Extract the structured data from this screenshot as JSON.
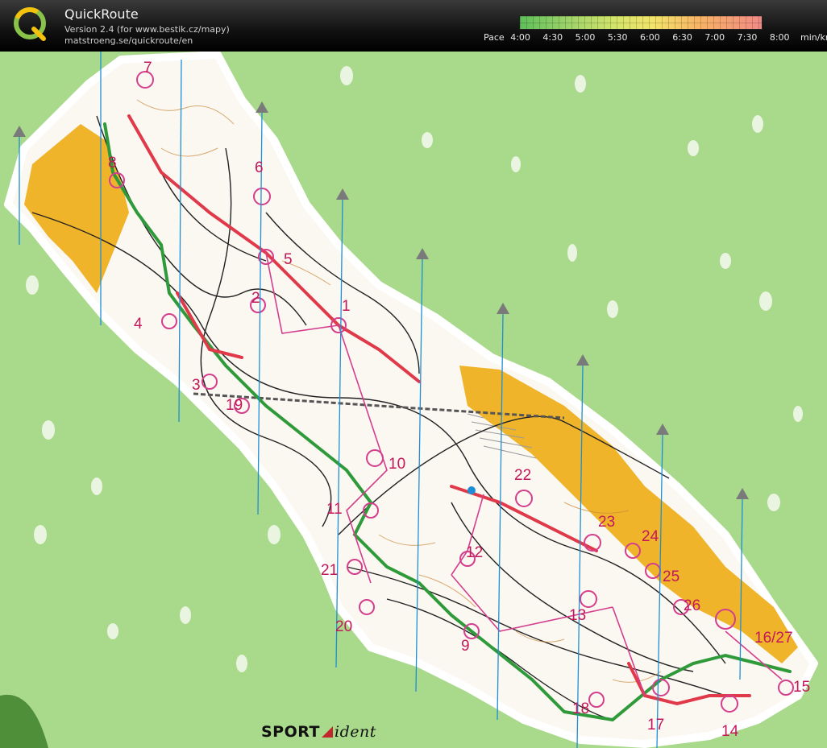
{
  "app": {
    "title": "QuickRoute",
    "version_line": "Version 2.4  (for www.bestik.cz/mapy)",
    "url_line": "matstroeng.se/quickroute/en"
  },
  "pace_scale": {
    "label": "Pace",
    "ticks": [
      "4:00",
      "4:30",
      "5:00",
      "5:30",
      "6:00",
      "6:30",
      "7:00",
      "7:30",
      "8:00"
    ],
    "unit": "min/km",
    "colors": [
      "#5fbf5a",
      "#9ed36a",
      "#d6e56a",
      "#f3e46a",
      "#f7b265",
      "#f28a86"
    ]
  },
  "map": {
    "controls": [
      "1",
      "2",
      "3",
      "4",
      "5",
      "6",
      "7",
      "8",
      "9",
      "10",
      "11",
      "12",
      "13",
      "14",
      "15",
      "16/27",
      "17",
      "18",
      "19",
      "20",
      "21",
      "22",
      "23",
      "24",
      "25",
      "26"
    ],
    "route_color": "#e03a4a",
    "gps_color": "#2f9a3a",
    "land_color": "#fbf7f1",
    "field_color": "#f0b42a",
    "background_color": "#a9d98a",
    "logo": {
      "brand": "SPORT",
      "suffix": "ident"
    }
  }
}
